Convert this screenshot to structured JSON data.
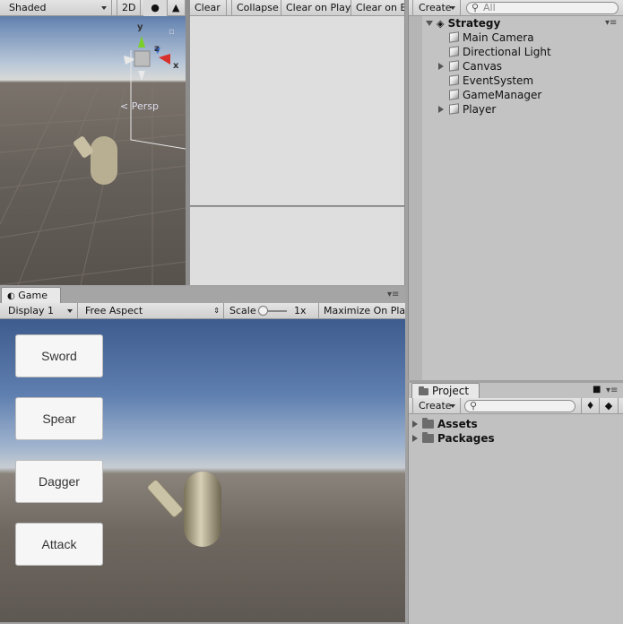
{
  "scene": {
    "shading_label": "Shaded",
    "mode_2d_label": "2D",
    "gizmo_y": "y",
    "gizmo_z": "z",
    "gizmo_x": "x",
    "persp_label": "Persp"
  },
  "console": {
    "clear_label": "Clear",
    "collapse_label": "Collapse",
    "clear_on_play_label": "Clear on Play",
    "clear_on_build_label": "Clear on Bu"
  },
  "game": {
    "tab_label": "Game",
    "display_label": "Display 1",
    "aspect_label": "Free Aspect",
    "scale_label": "Scale",
    "scale_value": "1x",
    "maximize_label": "Maximize On Play",
    "buttons": [
      "Sword",
      "Spear",
      "Dagger",
      "Attack"
    ]
  },
  "hierarchy": {
    "create_label": "Create",
    "search_placeholder": "All",
    "scene_name": "Strategy",
    "items": [
      {
        "label": "Main Camera",
        "expandable": false
      },
      {
        "label": "Directional Light",
        "expandable": false
      },
      {
        "label": "Canvas",
        "expandable": true
      },
      {
        "label": "EventSystem",
        "expandable": false
      },
      {
        "label": "GameManager",
        "expandable": false
      },
      {
        "label": "Player",
        "expandable": true
      }
    ]
  },
  "project": {
    "tab_label": "Project",
    "create_label": "Create",
    "folders": [
      "Assets",
      "Packages"
    ]
  },
  "colors": {
    "gizmo_y": "#7ccf2a",
    "gizmo_z": "#3a6fd6",
    "gizmo_x": "#d8302a"
  }
}
